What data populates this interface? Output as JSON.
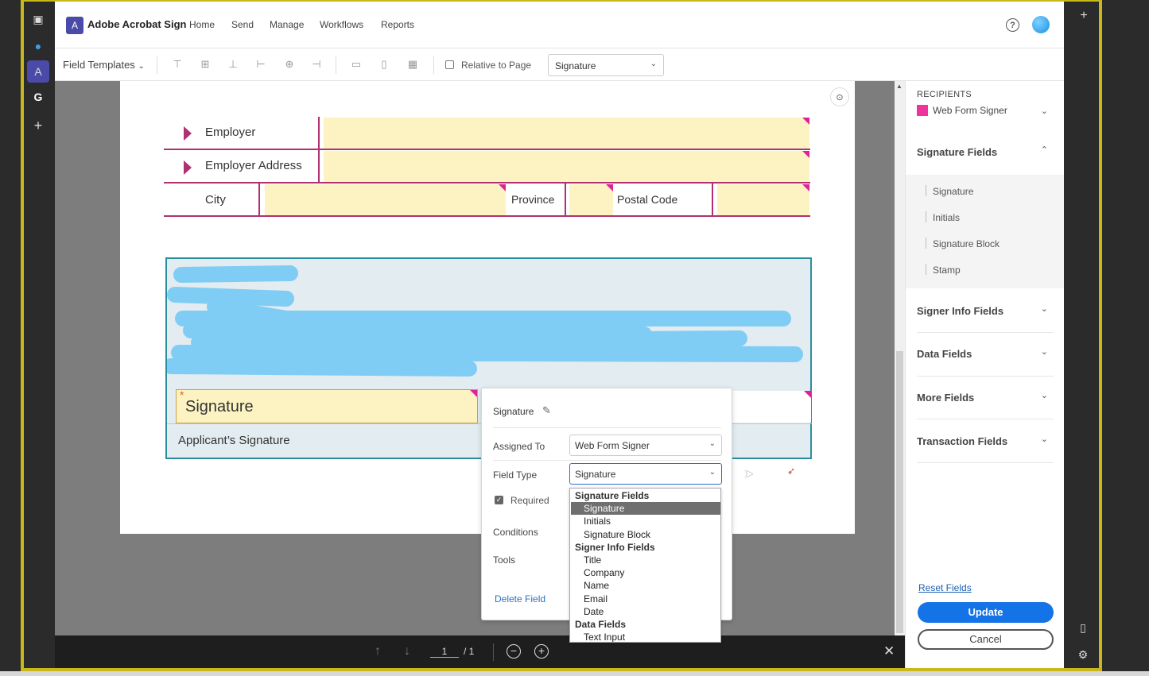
{
  "app": {
    "title": "Adobe Acrobat Sign",
    "logo_glyph": "A"
  },
  "nav": {
    "links": [
      "Home",
      "Send",
      "Manage",
      "Workflows",
      "Reports"
    ],
    "help": "?"
  },
  "toolbar": {
    "field_templates": "Field Templates",
    "relative_to_page": "Relative to Page",
    "field_type_select": "Signature"
  },
  "form": {
    "employer": "Employer",
    "employer_address": "Employer Address",
    "city": "City",
    "province": "Province",
    "postal_code": "Postal Code",
    "signature_field": "Signature",
    "applicant_signature": "Applicant’s Signature",
    "required_star": "*"
  },
  "popover": {
    "title": "Signature",
    "assigned_to_label": "Assigned To",
    "assigned_to_value": "Web Form Signer",
    "field_type_label": "Field Type",
    "field_type_value": "Signature",
    "required_label": "Required",
    "required_checked": true,
    "conditions_label": "Conditions",
    "tools_label": "Tools",
    "delete_field": "Delete Field"
  },
  "dropdown": {
    "items": [
      {
        "label": "Signature Fields",
        "kind": "group"
      },
      {
        "label": "Signature",
        "kind": "option",
        "selected": true
      },
      {
        "label": "Initials",
        "kind": "option"
      },
      {
        "label": "Signature Block",
        "kind": "option"
      },
      {
        "label": "Signer Info Fields",
        "kind": "group"
      },
      {
        "label": "Title",
        "kind": "option"
      },
      {
        "label": "Company",
        "kind": "option"
      },
      {
        "label": "Name",
        "kind": "option"
      },
      {
        "label": "Email",
        "kind": "option"
      },
      {
        "label": "Date",
        "kind": "option"
      },
      {
        "label": "Data Fields",
        "kind": "group"
      },
      {
        "label": "Text Input",
        "kind": "option"
      }
    ]
  },
  "pager": {
    "current": "1",
    "total": "/ 1"
  },
  "right_panel": {
    "recipients_heading": "RECIPIENTS",
    "recipient_name": "Web Form Signer",
    "recipient_color": "#f0339a",
    "signature_fields": "Signature Fields",
    "signature_items": [
      "Signature",
      "Initials",
      "Signature Block",
      "Stamp"
    ],
    "signer_info_fields": "Signer Info Fields",
    "data_fields": "Data Fields",
    "more_fields": "More Fields",
    "transaction_fields": "Transaction Fields",
    "reset_fields": "Reset Fields",
    "update": "Update",
    "cancel": "Cancel"
  },
  "colors": {
    "accent": "#1473e6",
    "field_fill": "#fdf3c2",
    "row_line": "#b03070",
    "section_border": "#2a8f9c"
  }
}
